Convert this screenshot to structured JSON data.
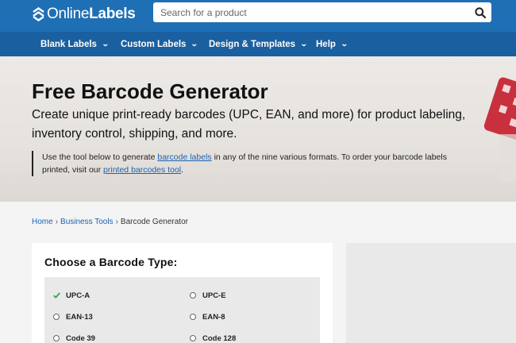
{
  "header": {
    "logo": {
      "text_regular": "Online",
      "text_bold": "Labels",
      "icon": "logo-chevrons-icon"
    },
    "search": {
      "placeholder": "Search for a product",
      "value": "",
      "icon": "search-icon"
    }
  },
  "nav": {
    "items": [
      {
        "label": "Blank Labels"
      },
      {
        "label": "Custom Labels"
      },
      {
        "label": "Design & Templates"
      },
      {
        "label": "Help"
      }
    ]
  },
  "hero": {
    "title": "Free Barcode Generator",
    "subtitle": "Create unique print-ready barcodes (UPC, EAN, and more) for product labeling, inventory control, shipping, and more.",
    "note": {
      "part1": "Use the tool below to generate ",
      "link1": "barcode labels",
      "part2": " in any of the nine various formats. To order your barcode labels printed, visit our ",
      "link2": "printed barcodes tool",
      "part3": "."
    }
  },
  "breadcrumb": {
    "items": [
      "Home",
      "Business Tools"
    ],
    "current": "Barcode Generator",
    "separator": "›"
  },
  "barcode_panel": {
    "title": "Choose a Barcode Type:",
    "options": [
      {
        "label": "UPC-A",
        "selected": true
      },
      {
        "label": "UPC-E",
        "selected": false
      },
      {
        "label": "EAN-13",
        "selected": false
      },
      {
        "label": "EAN-8",
        "selected": false
      },
      {
        "label": "Code 39",
        "selected": false
      },
      {
        "label": "Code 128",
        "selected": false
      }
    ]
  },
  "colors": {
    "topbar": "#1f6fb5",
    "navbar": "#1a5f9f",
    "link": "#1b62b0",
    "check": "#3aa444"
  }
}
